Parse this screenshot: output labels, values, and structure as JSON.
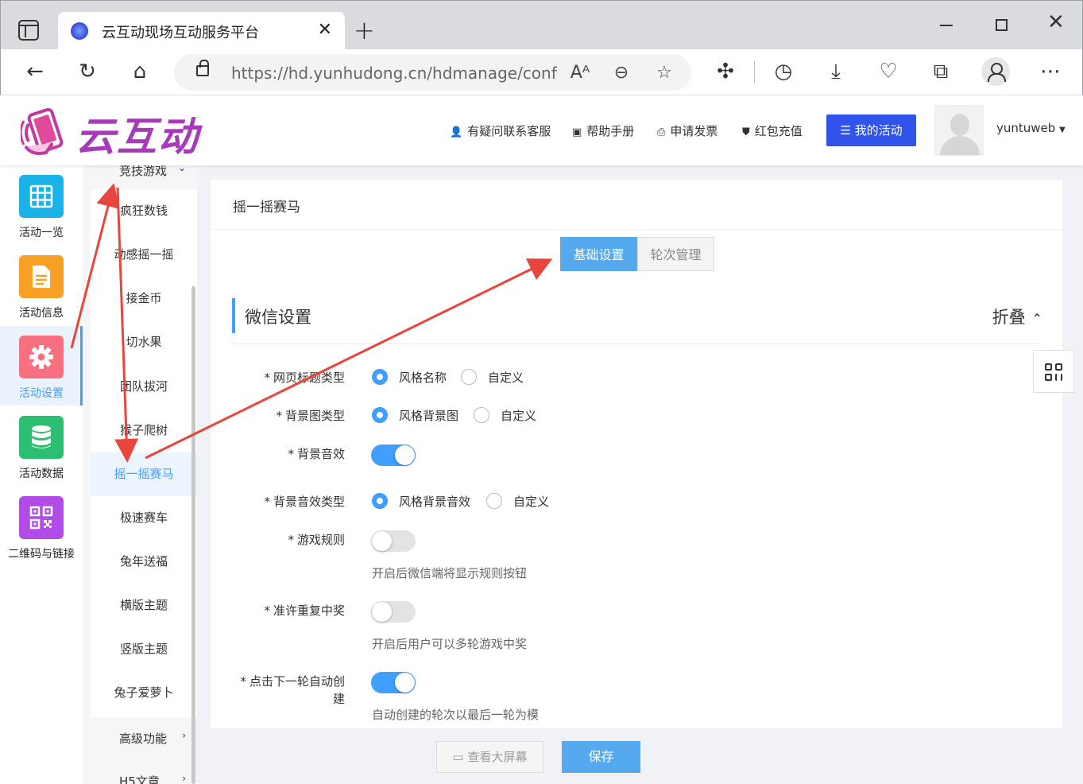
{
  "browser": {
    "tab_title": "云互动现场互动服务平台",
    "url_host": "https://hd.yunhudong.cn",
    "url_path": "/hdmanage/confi..."
  },
  "header": {
    "logo_text": "云互动",
    "nav": [
      {
        "label": "有疑问联系客服",
        "icon": "user-plus-icon"
      },
      {
        "label": "帮助手册",
        "icon": "book-icon"
      },
      {
        "label": "申请发票",
        "icon": "printer-icon"
      },
      {
        "label": "红包充值",
        "icon": "shield-check-icon"
      }
    ],
    "my_activity": "我的活动",
    "username": "yuntuweb"
  },
  "sidebar": {
    "items": [
      {
        "label": "活动一览",
        "color": "#1ab3e8",
        "icon": "grid-icon"
      },
      {
        "label": "活动信息",
        "color": "#f7a023",
        "icon": "document-icon"
      },
      {
        "label": "活动设置",
        "color": "#f35b6e",
        "icon": "gear-icon",
        "active": true
      },
      {
        "label": "活动数据",
        "color": "#2bbf72",
        "icon": "database-icon"
      },
      {
        "label": "二维码与链接",
        "color": "#b14ce6",
        "icon": "qrcode-icon"
      }
    ]
  },
  "submenu": {
    "group_top": "竞技游戏",
    "items": [
      "疯狂数钱",
      "动感摇一摇",
      "接金币",
      "切水果",
      "团队拔河",
      "猴子爬树",
      "摇一摇赛马",
      "极速赛车",
      "兔年送福",
      "横版主题",
      "竖版主题",
      "兔子爱萝卜"
    ],
    "active_index": 6,
    "group_advanced": "高级功能",
    "group_h5": "H5文章"
  },
  "main": {
    "title": "摇一摇赛马",
    "tabs": [
      {
        "label": "基础设置",
        "active": true
      },
      {
        "label": "轮次管理",
        "active": false
      }
    ],
    "section_title": "微信设置",
    "collapse_label": "折叠",
    "form": {
      "page_title_type": {
        "label": "网页标题类型",
        "options": [
          "风格名称",
          "自定义"
        ],
        "selected": 0
      },
      "bg_image_type": {
        "label": "背景图类型",
        "options": [
          "风格背景图",
          "自定义"
        ],
        "selected": 0
      },
      "bg_sound": {
        "label": "背景音效",
        "on": true
      },
      "bg_sound_type": {
        "label": "背景音效类型",
        "options": [
          "风格背景音效",
          "自定义"
        ],
        "selected": 0
      },
      "game_rules": {
        "label": "游戏规则",
        "on": false,
        "help": "开启后微信端将显示规则按钮"
      },
      "allow_repeat": {
        "label": "准许重复中奖",
        "on": false,
        "help": "开启后用户可以多轮游戏中奖"
      },
      "auto_create": {
        "label_1": "点击下一轮自动创",
        "label_2": "建",
        "on": true,
        "help": "自动创建的轮次以最后一轮为模"
      }
    }
  },
  "footer": {
    "preview_label": "查看大屏幕",
    "save_label": "保存"
  },
  "colors": {
    "accent": "#409eff",
    "primary_button": "#3054eb",
    "annotation_arrow": "#e8453c"
  }
}
